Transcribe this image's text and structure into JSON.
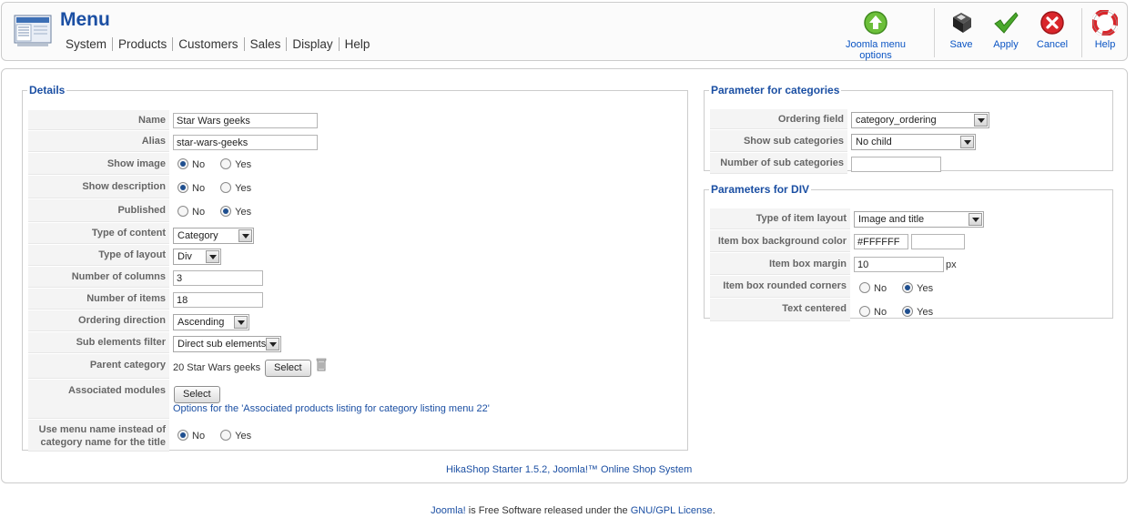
{
  "header": {
    "title": "Menu",
    "menu": [
      "System",
      "Products",
      "Customers",
      "Sales",
      "Display",
      "Help"
    ],
    "toolbar": {
      "joomla_menu_options": "Joomla menu options",
      "save": "Save",
      "apply": "Apply",
      "cancel": "Cancel",
      "help": "Help"
    }
  },
  "details": {
    "legend": "Details",
    "name_label": "Name",
    "name_value": "Star Wars geeks",
    "alias_label": "Alias",
    "alias_value": "star-wars-geeks",
    "show_image_label": "Show image",
    "show_description_label": "Show description",
    "published_label": "Published",
    "no": "No",
    "yes": "Yes",
    "type_of_content_label": "Type of content",
    "type_of_content_value": "Category",
    "type_of_layout_label": "Type of layout",
    "type_of_layout_value": "Div",
    "number_of_columns_label": "Number of columns",
    "number_of_columns_value": "3",
    "number_of_items_label": "Number of items",
    "number_of_items_value": "18",
    "ordering_direction_label": "Ordering direction",
    "ordering_direction_value": "Ascending",
    "sub_elements_filter_label": "Sub elements filter",
    "sub_elements_filter_value": "Direct sub elements",
    "parent_category_label": "Parent category",
    "parent_category_value": "20 Star Wars geeks",
    "select": "Select",
    "associated_modules_label": "Associated modules",
    "associated_modules_link": "Options for the 'Associated products listing for category listing menu 22'",
    "use_menu_name_label_1": "Use menu name instead of",
    "use_menu_name_label_2": "category name for the title"
  },
  "categories": {
    "legend": "Parameter for categories",
    "ordering_field_label": "Ordering field",
    "ordering_field_value": "category_ordering",
    "show_sub_categories_label": "Show sub categories",
    "show_sub_categories_value": "No child",
    "number_of_sub_categories_label": "Number of sub categories",
    "number_of_sub_categories_value": ""
  },
  "div_params": {
    "legend": "Parameters for DIV",
    "item_layout_label": "Type of item layout",
    "item_layout_value": "Image and title",
    "bg_color_label": "Item box background color",
    "bg_color_value": "#FFFFFF",
    "margin_label": "Item box margin",
    "margin_value": "10",
    "margin_unit": "px",
    "rounded_label": "Item box rounded corners",
    "centered_label": "Text centered",
    "no": "No",
    "yes": "Yes"
  },
  "hikashop_footer": "HikaShop Starter 1.5.2, Joomla!™ Online Shop System",
  "page_footer": {
    "joomla": "Joomla!",
    "middle": " is Free Software released under the ",
    "license": "GNU/GPL License",
    "end": "."
  }
}
